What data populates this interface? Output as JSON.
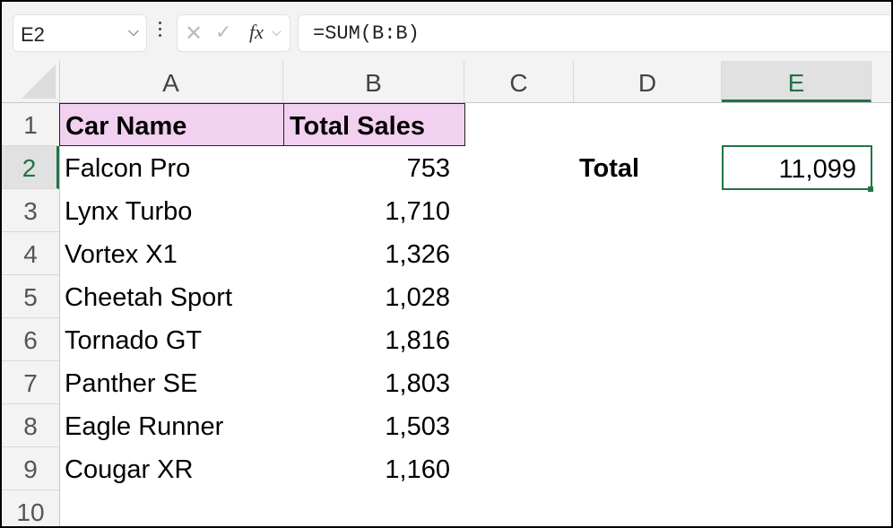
{
  "formula_bar": {
    "name_box": "E2",
    "cancel_icon": "✕",
    "enter_icon": "✓",
    "fx_label": "fx",
    "formula": "=SUM(B:B)"
  },
  "columns": [
    "A",
    "B",
    "C",
    "D",
    "E"
  ],
  "rows": [
    "1",
    "2",
    "3",
    "4",
    "5",
    "6",
    "7",
    "8",
    "9",
    "10"
  ],
  "selected_cell": "E2",
  "table": {
    "headers": [
      "Car Name",
      "Total Sales"
    ],
    "rows": [
      {
        "name": "Falcon Pro",
        "sales": "753"
      },
      {
        "name": "Lynx Turbo",
        "sales": "1,710"
      },
      {
        "name": "Vortex X1",
        "sales": "1,326"
      },
      {
        "name": "Cheetah Sport",
        "sales": "1,028"
      },
      {
        "name": "Tornado GT",
        "sales": "1,816"
      },
      {
        "name": "Panther SE",
        "sales": "1,803"
      },
      {
        "name": "Eagle Runner",
        "sales": "1,503"
      },
      {
        "name": "Cougar XR",
        "sales": "1,160"
      }
    ]
  },
  "summary": {
    "label": "Total",
    "value": "11,099"
  },
  "colors": {
    "accent": "#217346",
    "header_fill": "#f2d0ef"
  }
}
